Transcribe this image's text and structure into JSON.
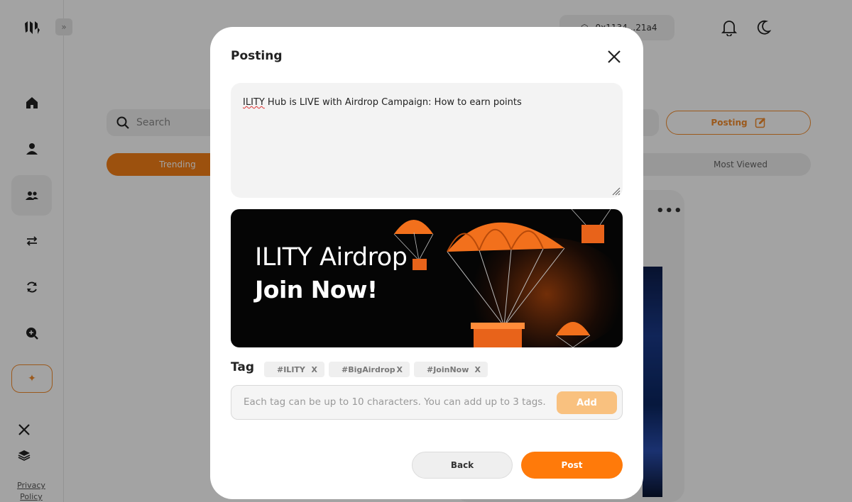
{
  "wallet": {
    "address": "0x1134...21a4"
  },
  "search": {
    "placeholder": "Search"
  },
  "header": {
    "posting_label": "Posting"
  },
  "tabs": {
    "trending": "Trending",
    "most_viewed": "Most Viewed"
  },
  "sidebar": {
    "items": [
      "home-icon",
      "profile-icon",
      "community-icon",
      "swap-icon",
      "refresh-icon",
      "search-plus-icon"
    ],
    "active_index": 2,
    "footer": {
      "privacy": "Privacy Policy"
    }
  },
  "feed": {
    "menu_label": "•••"
  },
  "modal": {
    "title": "Posting",
    "post_text_prefix": "ILITY",
    "post_text_rest": " Hub is LIVE with Airdrop Campaign: How to earn points",
    "banner": {
      "line1": "ILITY Airdrop",
      "line2": "Join Now!"
    },
    "tag_label": "Tag",
    "tags": [
      "#ILITY",
      "#BigAirdrop",
      "#JoinNow"
    ],
    "tag_remove_label": "X",
    "tag_input_placeholder": "Each tag can be up to 10 characters. You can add up to 3 tags.",
    "add_label": "Add",
    "back_label": "Back",
    "post_label": "Post"
  },
  "colors": {
    "accent": "#f57f17",
    "post_button": "#ff7a0a",
    "add_button": "#f9c17f"
  }
}
